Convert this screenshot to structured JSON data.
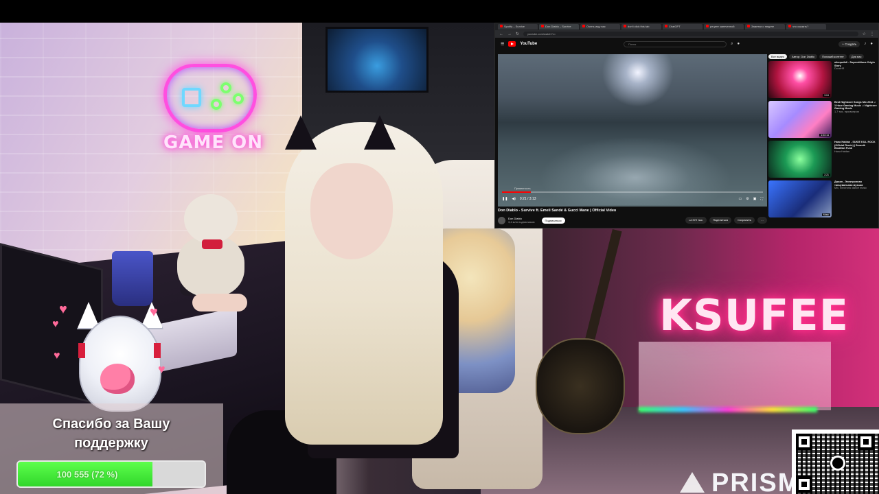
{
  "scene": {
    "neon_game_text": "GAME ON",
    "neon_name": "KSUFEE",
    "brand_watermark": "PRISM"
  },
  "browser": {
    "tabs": [
      {
        "label": "Spotify – Survive",
        "active": false
      },
      {
        "label": "Don Diablo – Survive",
        "active": true
      },
      {
        "label": "Очень ищу вас",
        "active": false
      },
      {
        "label": "don't click this tab",
        "active": false
      },
      {
        "label": "ChatGPT",
        "active": false
      },
      {
        "label": "рецепт запеченной",
        "active": false
      },
      {
        "label": "Заметки о неделе",
        "active": false
      },
      {
        "label": "что сказать?",
        "active": false
      }
    ],
    "url": "youtube.com/watch?v=",
    "youtube": {
      "brand": "YouTube",
      "search_placeholder": "Поиск",
      "create_label": "+ Создать",
      "video": {
        "title": "Don Diablo - Survive ft. Emeli Sandé & Gucci Mane | Official Video",
        "time": "0:21 / 3:13",
        "progress": 0.11,
        "chapter": "Приватность"
      },
      "channel": {
        "name": "Don Diablo",
        "subscribers": "3,4 млн подписчиков",
        "subscribe_label": "Подписаться"
      },
      "actions": {
        "likes": "372 тыс.",
        "share": "Поделиться",
        "save": "Сохранить"
      },
      "sidebar_chips": [
        {
          "label": "Все видео",
          "active": true
        },
        {
          "label": "Автор: Don Diablo",
          "active": false
        },
        {
          "label": "Похожий контент",
          "active": false
        },
        {
          "label": "Для вас",
          "active": false
        }
      ],
      "recommended": [
        {
          "title": "whoqudidi - Superstitious Origin Story",
          "meta": "DovaHR",
          "duration": "3:04"
        },
        {
          "title": "Best Nightcore Songs Mix 2024 ♫ 1 Hour Gaming Music ♫ Nightcore Gaming Music",
          "meta": "1,7 тыс. просмотров",
          "duration": "1:03:14"
        },
        {
          "title": "Hana Haldan - SUKIE KILL ROCK (Official Remix) | Smooth Brazilian Funk",
          "meta": "Hana Haldan",
          "duration": "2:21"
        },
        {
          "title": "Джоан - Электронная танцевальная музыка",
          "meta": "Mix, Electronic dance music",
          "duration": "Микс"
        }
      ]
    }
  },
  "alert": {
    "message": "Спасибо за Вашу поддержку",
    "goal_label": "100 555 (72 %)",
    "goal_fraction": 0.72
  },
  "colors": {
    "goal_green": "#31d62b",
    "neon_pink": "#ff2f8a",
    "youtube_red": "#ff0000"
  }
}
